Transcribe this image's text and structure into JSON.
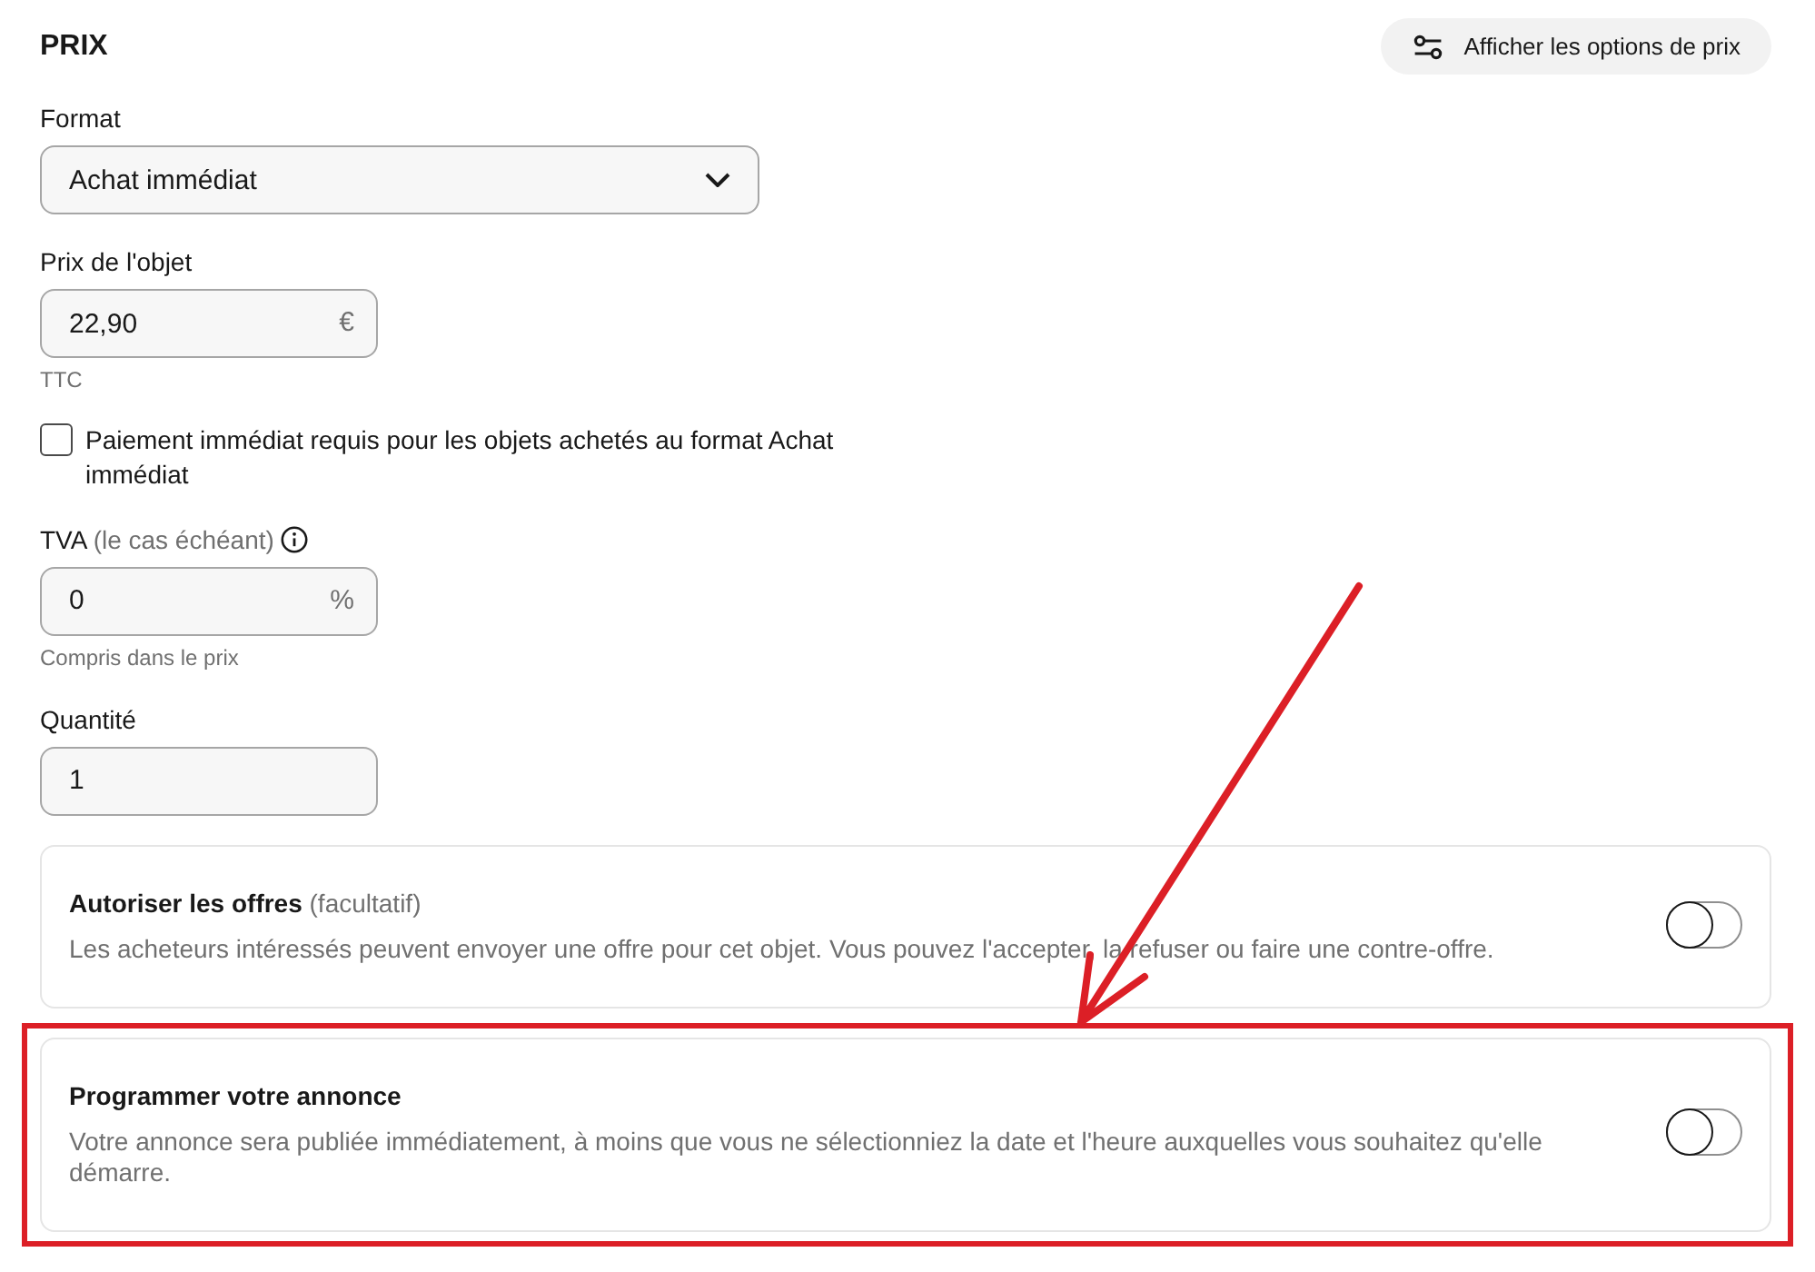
{
  "section": {
    "title": "PRIX",
    "options_button": {
      "label": "Afficher les options de prix"
    }
  },
  "fields": [
    {
      "kind": "select",
      "label": "Format",
      "value": "Achat immédiat"
    },
    {
      "kind": "input",
      "label": "Prix de l'objet",
      "value": "22,90",
      "unit": "€",
      "hint": "TTC"
    },
    {
      "kind": "checkbox",
      "label": "Paiement immédiat requis pour les objets achetés au format Achat immédiat",
      "checked": false
    },
    {
      "kind": "input",
      "label": "TVA",
      "label_note": "(le cas échéant)",
      "info": true,
      "value": "0",
      "unit": "%",
      "hint": "Compris dans le prix"
    },
    {
      "kind": "input",
      "label": "Quantité",
      "value": "1"
    }
  ],
  "cards": [
    {
      "title": "Autoriser les offres",
      "title_note": "(facultatif)",
      "description": "Les acheteurs intéressés peuvent envoyer une offre pour cet objet. Vous pouvez l'accepter, la refuser ou faire une contre-offre.",
      "on": false,
      "highlighted": false
    },
    {
      "title": "Programmer votre annonce",
      "description": "Votre annonce sera publiée immédiatement, à moins que vous ne sélectionniez la date et l'heure auxquelles vous souhaitez qu'elle démarre.",
      "on": false,
      "highlighted": true
    }
  ]
}
